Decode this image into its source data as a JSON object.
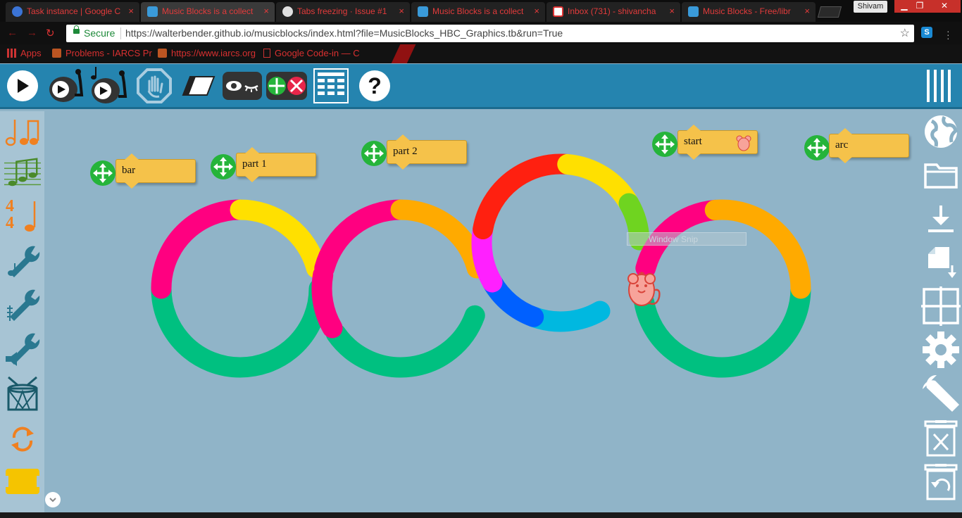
{
  "browser": {
    "tabs": [
      {
        "title": "Task instance | Google C",
        "fav_color": "#3b74d6"
      },
      {
        "title": "Music Blocks is a collect",
        "fav_color": "#3a9ad9"
      },
      {
        "title": "Tabs freezing · Issue #1",
        "fav_color": "#e0e0e0"
      },
      {
        "title": "Music Blocks is a collect",
        "fav_color": "#3a9ad9"
      },
      {
        "title": "Inbox (731) - shivancha",
        "fav_color": "#d33"
      },
      {
        "title": "Music Blocks - Free/libr",
        "fav_color": "#3a9ad9"
      }
    ],
    "close_glyph": "×",
    "user": "Shivam",
    "window_buttons": {
      "minimize": "▁",
      "maximize": "❐",
      "close": "✕"
    },
    "secure_label": "Secure",
    "url": "https://walterbender.github.io/musicblocks/index.html?file=MusicBlocks_HBC_Graphics.tb&run=True",
    "bookmarks": [
      {
        "label": "Apps",
        "icon": "apps-grid-icon"
      },
      {
        "label": "Problems - IARCS Pr",
        "icon": "iarcs-icon"
      },
      {
        "label": "https://www.iarcs.org",
        "icon": "iarcs-icon"
      },
      {
        "label": "Google Code-in — C",
        "icon": "page-icon"
      }
    ]
  },
  "toolbar": {
    "icons": [
      "play-icon",
      "play-slow-icon",
      "play-step-icon",
      "stop-icon",
      "erase-icon",
      "hide-blocks-icon",
      "collapse-blocks-icon",
      "block-grid-icon",
      "help-icon"
    ],
    "menu_icon": "hamburger-menu-icon",
    "help_glyph": "?"
  },
  "palette": {
    "items": [
      "rhythm-notes-icon",
      "pitch-notes-icon",
      "meter-icon",
      "music-tools-icon",
      "pitch-tools-icon",
      "volume-tools-icon",
      "drum-icon",
      "flow-icon",
      "action-block-icon"
    ],
    "meter_glyphs": [
      "4",
      "4"
    ]
  },
  "sidebar": {
    "items": [
      "planet-icon",
      "open-folder-icon",
      "save-download-icon",
      "new-project-icon",
      "grid-icon",
      "settings-gear-icon",
      "advanced-wrench-icon",
      "trash-icon",
      "restore-icon"
    ]
  },
  "canvas": {
    "blocks": [
      {
        "label": "bar"
      },
      {
        "label": "part 1"
      },
      {
        "label": "part 2"
      },
      {
        "label": "start"
      },
      {
        "label": "arc"
      }
    ],
    "turtle": "mouse-turtle-icon",
    "snip_overlay": "Window Snip",
    "colors": {
      "green": "#00c080",
      "pink": "#ff0080",
      "yellow": "#ffe000",
      "orange": "#ffaa00",
      "red": "#ff2010",
      "lime": "#6fd420",
      "magenta": "#ff20ff",
      "blue": "#0060ff",
      "cyan": "#00b8e0"
    }
  }
}
